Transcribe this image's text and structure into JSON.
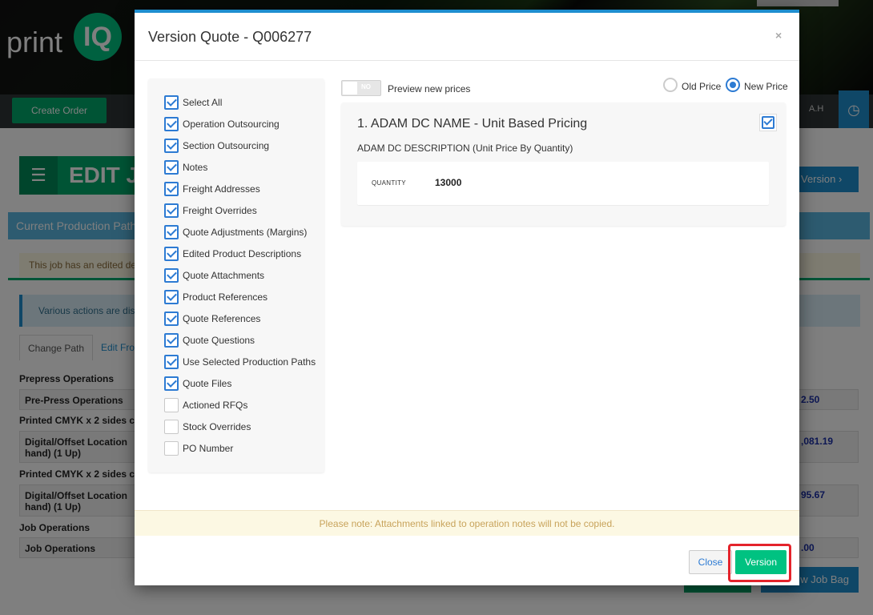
{
  "background": {
    "logo_text": "print",
    "logo_badge": "IQ",
    "create_order": "Create Order",
    "user_initials": "A.H",
    "page_title": "EDIT J",
    "version_button": "Version",
    "current_path": "Current Production Path",
    "edited_warning": "This job has an edited des",
    "actions_info": "Various actions are disal",
    "tabs": [
      "Change Path",
      "Edit Fro"
    ],
    "sections": [
      {
        "heading": "Prepress Operations",
        "row": "Pre-Press Operations",
        "amount": "2.50"
      },
      {
        "heading": "Printed CMYK x 2 sides c",
        "row": "Digital/Offset Location\nhand) (1 Up)",
        "amount": ",081.19"
      },
      {
        "heading": "Printed CMYK x 2 sides c",
        "row": "Digital/Offset Location\nhand) (1 Up)",
        "amount": "95.67"
      },
      {
        "heading": "Job Operations",
        "row": "Job Operations",
        "amount": ".00"
      }
    ],
    "bottom_button": "w Job Bag"
  },
  "modal": {
    "title": "Version Quote - Q006277",
    "close_symbol": "×",
    "options": [
      {
        "label": "Select All",
        "checked": true
      },
      {
        "label": "Operation Outsourcing",
        "checked": true
      },
      {
        "label": "Section Outsourcing",
        "checked": true
      },
      {
        "label": "Notes",
        "checked": true
      },
      {
        "label": "Freight Addresses",
        "checked": true
      },
      {
        "label": "Freight Overrides",
        "checked": true
      },
      {
        "label": "Quote Adjustments (Margins)",
        "checked": true
      },
      {
        "label": "Edited Product Descriptions",
        "checked": true
      },
      {
        "label": "Quote Attachments",
        "checked": true
      },
      {
        "label": "Product References",
        "checked": true
      },
      {
        "label": "Quote References",
        "checked": true
      },
      {
        "label": "Quote Questions",
        "checked": true
      },
      {
        "label": "Use Selected Production Paths",
        "checked": true
      },
      {
        "label": "Quote Files",
        "checked": true
      },
      {
        "label": "Actioned RFQs",
        "checked": false
      },
      {
        "label": "Stock Overrides",
        "checked": false
      },
      {
        "label": "PO Number",
        "checked": false
      }
    ],
    "preview_toggle_state": "NO",
    "preview_label": "Preview new prices",
    "price_options": {
      "old": "Old Price",
      "new": "New Price",
      "selected": "new"
    },
    "product": {
      "title": "1. ADAM DC NAME - Unit Based Pricing",
      "description": "ADAM DC DESCRIPTION (Unit Price By Quantity)",
      "quantity_label": "QUANTITY",
      "quantity_value": "13000",
      "selected": true
    },
    "note": "Please note: Attachments linked to operation notes will not be copied.",
    "footer": {
      "close": "Close",
      "version": "Version"
    }
  },
  "colors": {
    "accent": "#1e8ecf",
    "primary_green": "#00c281",
    "highlight_red": "#e4232b",
    "checkbox_blue": "#2d7bd3"
  }
}
